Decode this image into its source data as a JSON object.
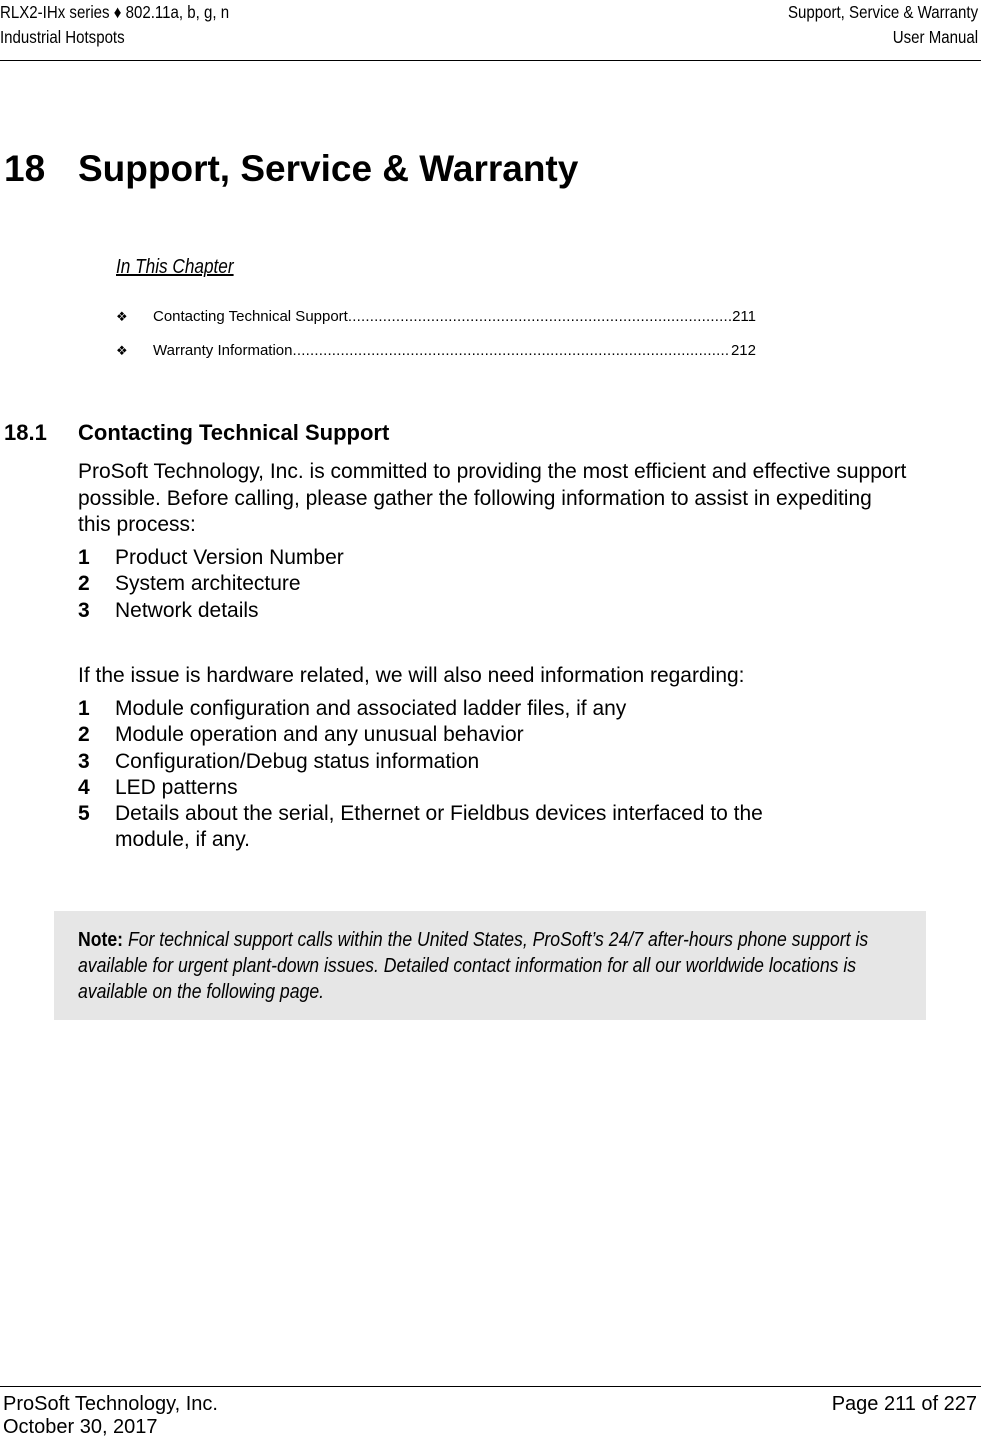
{
  "header": {
    "left_line1": "RLX2-IHx series ♦ 802.11a, b, g, n",
    "left_line2": "Industrial Hotspots",
    "right_line1": "Support, Service & Warranty",
    "right_line2": "User Manual"
  },
  "chapter": {
    "number": "18",
    "title": "Support, Service & Warranty"
  },
  "toc": {
    "heading": "In This Chapter",
    "bullet_icon": "❖",
    "items": [
      {
        "label": "Contacting Technical Support",
        "page": "211"
      },
      {
        "label": "Warranty Information",
        "page": "212"
      }
    ]
  },
  "section": {
    "number": "18.1",
    "title": "Contacting Technical Support",
    "intro": "ProSoft Technology, Inc. is committed to providing the most efficient and effective support possible. Before calling, please gather the following information to assist in expediting this process:",
    "list1": [
      {
        "n": "1",
        "text": "Product Version Number"
      },
      {
        "n": "2",
        "text": "System architecture"
      },
      {
        "n": "3",
        "text": "Network details"
      }
    ],
    "hardware_intro": "If the issue is hardware related, we will also need information regarding:",
    "list2": [
      {
        "n": "1",
        "text": "Module configuration and associated ladder files, if any"
      },
      {
        "n": "2",
        "text": "Module operation and any unusual behavior"
      },
      {
        "n": "3",
        "text": "Configuration/Debug status information"
      },
      {
        "n": "4",
        "text": "LED patterns"
      },
      {
        "n": "5",
        "text": "Details about the serial, Ethernet or Fieldbus devices interfaced to the module, if any."
      }
    ]
  },
  "note": {
    "label": "Note:",
    "text": "For technical support calls within the United States, ProSoft’s 24/7 after-hours phone support is available for urgent plant-down issues. Detailed contact information for all our worldwide locations is available on the following page."
  },
  "footer": {
    "company": "ProSoft Technology, Inc.",
    "date": "October 30, 2017",
    "page": "Page 211 of 227"
  }
}
